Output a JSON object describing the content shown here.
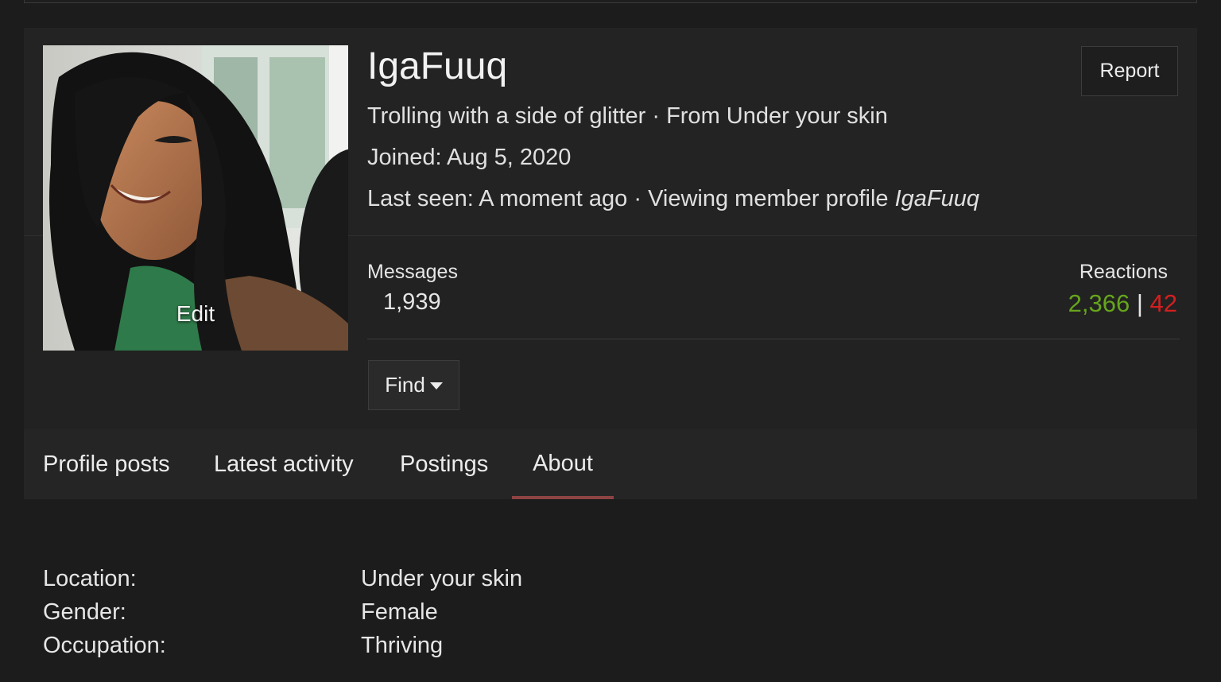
{
  "profile": {
    "username": "IgaFuuq",
    "avatar_edit_label": "Edit",
    "tagline": "Trolling with a side of glitter · From Under your skin",
    "joined_label": "Joined:",
    "joined_value": "Aug 5, 2020",
    "last_seen_label": "Last seen:",
    "last_seen_value": "A moment ago · Viewing member profile ",
    "last_seen_target": "IgaFuuq",
    "report_label": "Report"
  },
  "stats": {
    "messages_label": "Messages",
    "messages_value": "1,939",
    "reactions_label": "Reactions",
    "reactions_positive": "2,366",
    "reactions_separator": "|",
    "reactions_negative": "42",
    "positive_color": "#66a51c",
    "negative_color": "#d31f1f"
  },
  "find": {
    "label": "Find",
    "icon": "caret-down-icon"
  },
  "tabs": [
    {
      "label": "Profile posts",
      "active": false
    },
    {
      "label": "Latest activity",
      "active": false
    },
    {
      "label": "Postings",
      "active": false
    },
    {
      "label": "About",
      "active": true
    }
  ],
  "about": [
    {
      "label": "Location:",
      "value": "Under your skin"
    },
    {
      "label": "Gender:",
      "value": "Female"
    },
    {
      "label": "Occupation:",
      "value": "Thriving"
    }
  ],
  "colors": {
    "background": "#1c1c1c",
    "panel": "#232323",
    "tab_active_underline": "#8e4343"
  }
}
